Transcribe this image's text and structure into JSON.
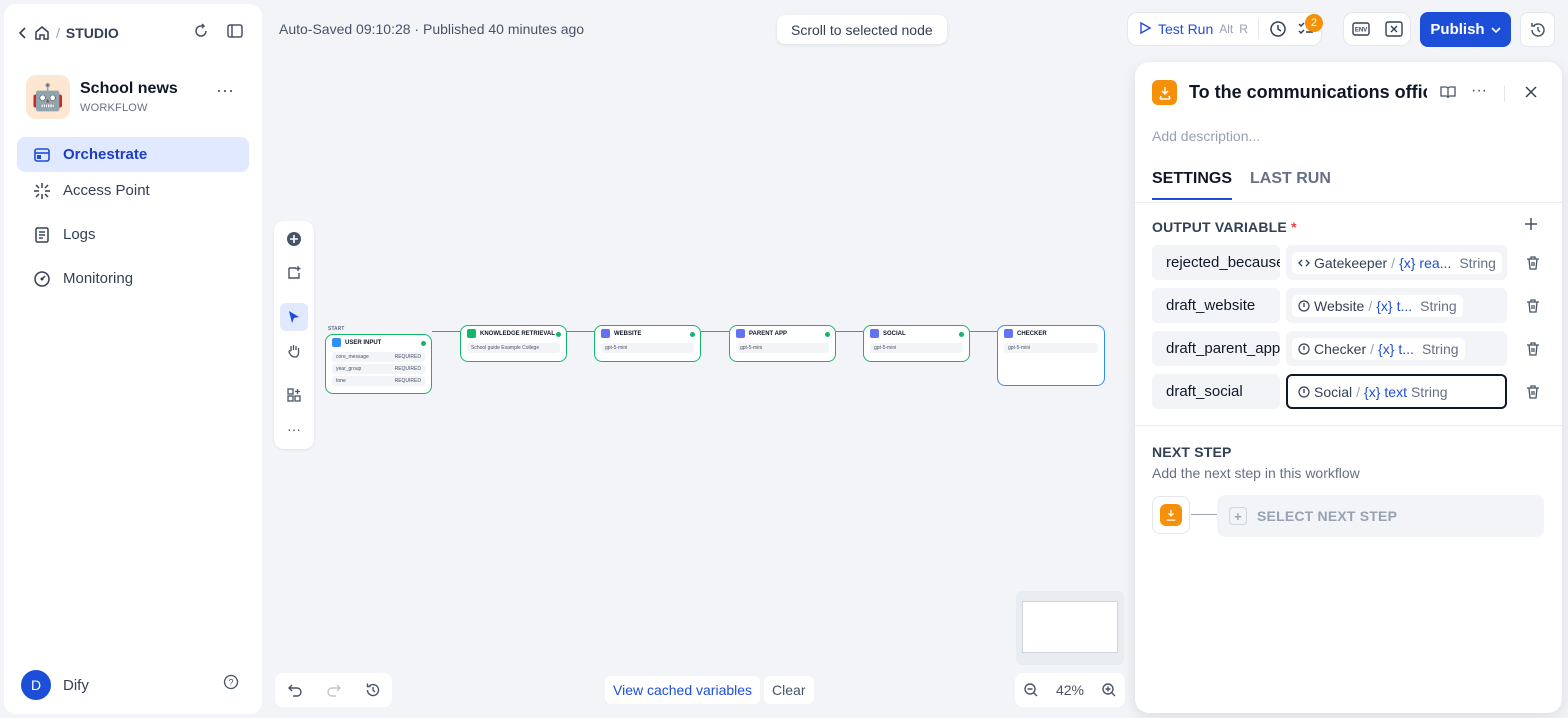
{
  "breadcrumb": {
    "section": "STUDIO"
  },
  "app": {
    "name": "School news",
    "type": "WORKFLOW"
  },
  "nav": [
    {
      "label": "Orchestrate",
      "active": true
    },
    {
      "label": "Access Point"
    },
    {
      "label": "Logs"
    },
    {
      "label": "Monitoring"
    }
  ],
  "user": {
    "initial": "D",
    "name": "Dify"
  },
  "header": {
    "status": "Auto-Saved 09:10:28 · Published 40 minutes ago",
    "scroll_to_selected": "Scroll to selected node",
    "test_run": "Test Run",
    "test_run_kbd1": "Alt",
    "test_run_kbd2": "R",
    "checklist_count": "2",
    "publish": "Publish"
  },
  "canvas": {
    "start_label": "START",
    "nodes": [
      {
        "title": "USER INPUT",
        "rows": [
          "core_message",
          "year_group",
          "tone"
        ],
        "req": "REQUIRED"
      },
      {
        "title": "KNOWLEDGE RETRIEVAL",
        "sub": "School guide Example College"
      },
      {
        "title": "WEBSITE",
        "sub": "gpt-5-mini"
      },
      {
        "title": "PARENT APP",
        "sub": "gpt-5-mini"
      },
      {
        "title": "SOCIAL",
        "sub": "gpt-5-mini"
      },
      {
        "title": "CHECKER",
        "sub": "gpt-5-mini"
      }
    ],
    "zoom": "42%",
    "view_cached": "View cached variables",
    "clear": "Clear"
  },
  "panel": {
    "title": "To the communications officer",
    "description_placeholder": "Add description...",
    "tabs": [
      "SETTINGS",
      "LAST RUN"
    ],
    "output_section": "OUTPUT VARIABLE",
    "required_mark": "*",
    "outputs": [
      {
        "name": "rejected_because",
        "node": "Gatekeeper",
        "var": "rea...",
        "type": "String",
        "focused": false
      },
      {
        "name": "draft_website",
        "node": "Website",
        "var": "t...",
        "type": "String",
        "focused": false
      },
      {
        "name": "draft_parent_app",
        "node": "Checker",
        "var": "t...",
        "type": "String",
        "focused": false
      },
      {
        "name": "draft_social",
        "node": "Social",
        "var": "text",
        "type": "String",
        "focused": true
      }
    ],
    "next_step_title": "NEXT STEP",
    "next_step_desc": "Add the next step in this workflow",
    "select_next": "SELECT NEXT STEP"
  }
}
